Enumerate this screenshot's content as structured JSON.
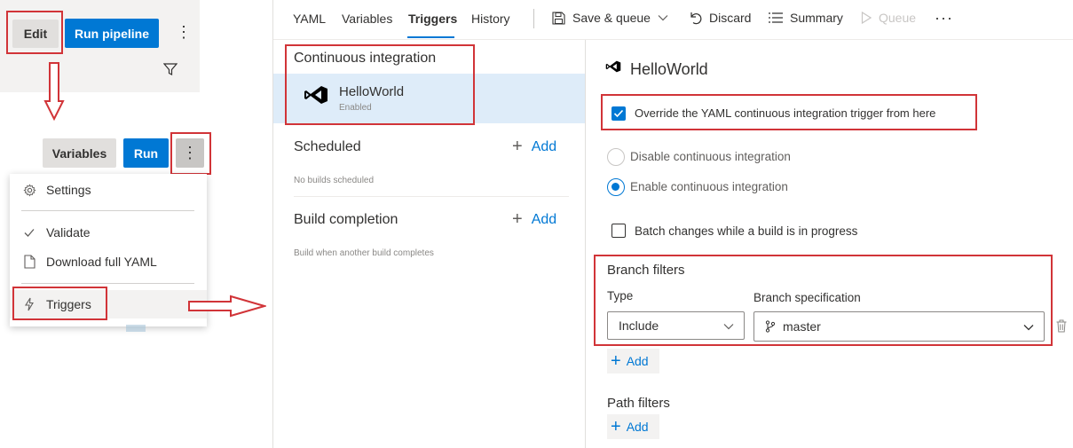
{
  "top_left": {
    "edit_label": "Edit",
    "run_pipeline_label": "Run pipeline",
    "more_glyph": "⋮"
  },
  "mid_left": {
    "variables_label": "Variables",
    "run_label": "Run",
    "more_glyph": "⋮"
  },
  "context_menu": {
    "items": [
      {
        "label": "Settings",
        "icon": "gear-icon"
      },
      {
        "label": "Validate",
        "icon": "checkmark-icon"
      },
      {
        "label": "Download full YAML",
        "icon": "document-icon"
      },
      {
        "label": "Triggers",
        "icon": "lightning-icon"
      }
    ]
  },
  "tabs": [
    {
      "label": "YAML",
      "active": false
    },
    {
      "label": "Variables",
      "active": false
    },
    {
      "label": "Triggers",
      "active": true
    },
    {
      "label": "History",
      "active": false
    }
  ],
  "toolbar": {
    "save_queue_label": "Save & queue",
    "discard_label": "Discard",
    "summary_label": "Summary",
    "queue_label": "Queue",
    "more_glyph": "···"
  },
  "triggers_list": {
    "ci_title": "Continuous integration",
    "ci_item_name": "HelloWorld",
    "ci_item_status": "Enabled",
    "scheduled_title": "Scheduled",
    "scheduled_add": "Add",
    "scheduled_empty": "No builds scheduled",
    "build_completion_title": "Build completion",
    "build_completion_add": "Add",
    "build_completion_desc": "Build when another build completes"
  },
  "details": {
    "title": "HelloWorld",
    "override_label": "Override the YAML continuous integration trigger from here",
    "override_checked": true,
    "disable_ci_label": "Disable continuous integration",
    "enable_ci_label": "Enable continuous integration",
    "batch_label": "Batch changes while a build is in progress",
    "batch_checked": false,
    "branch_filters_title": "Branch filters",
    "type_label": "Type",
    "type_value": "Include",
    "branch_spec_label": "Branch specification",
    "branch_spec_value": "master",
    "branch_add": "Add",
    "path_filters_title": "Path filters",
    "path_add": "Add"
  },
  "colors": {
    "accent": "#0078d4",
    "highlight_box": "#d13438",
    "selected_row": "#deecf9"
  }
}
